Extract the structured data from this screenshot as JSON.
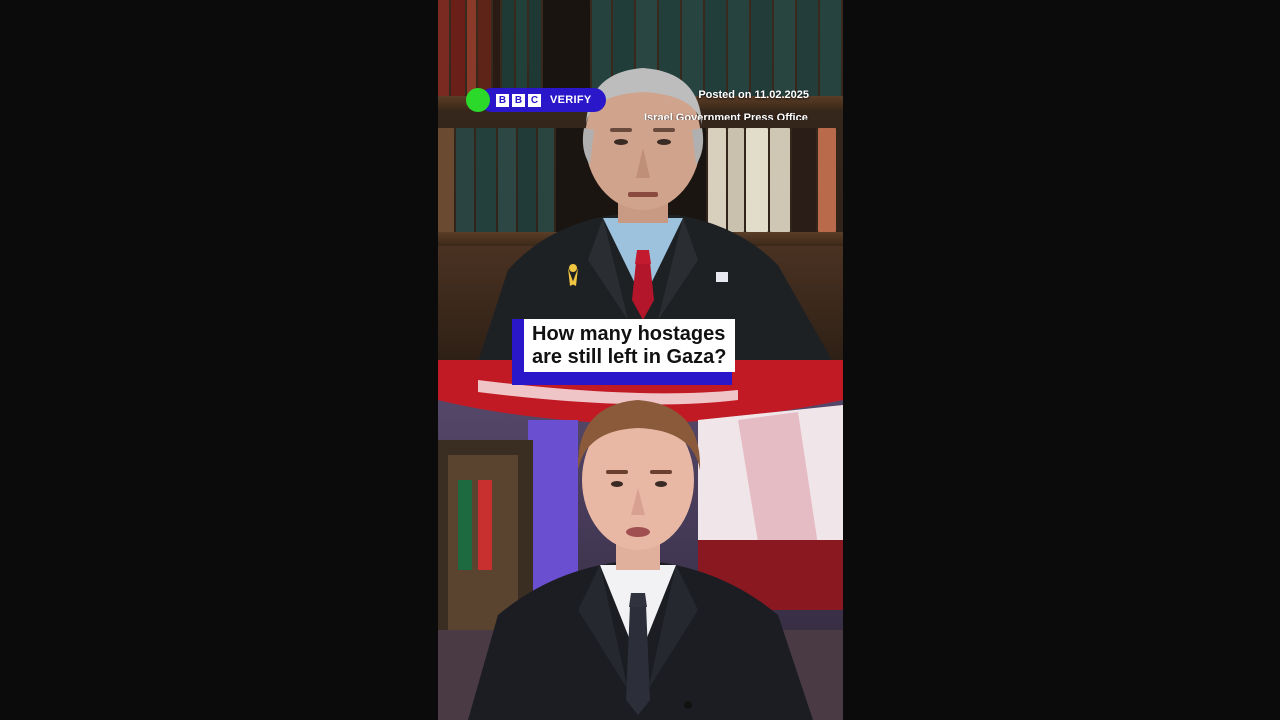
{
  "badge": {
    "brand_letters": [
      "B",
      "B",
      "C"
    ],
    "label": "VERIFY"
  },
  "meta": {
    "posted_on": "Posted on 11.02.2025",
    "source_credit": "Israel Government Press Office"
  },
  "headline": {
    "line1": "How many hostages",
    "line2": "are still left in Gaza?"
  },
  "colors": {
    "bbc_verify_blue": "#2a17c9",
    "live_dot_green": "#2bd92b"
  }
}
